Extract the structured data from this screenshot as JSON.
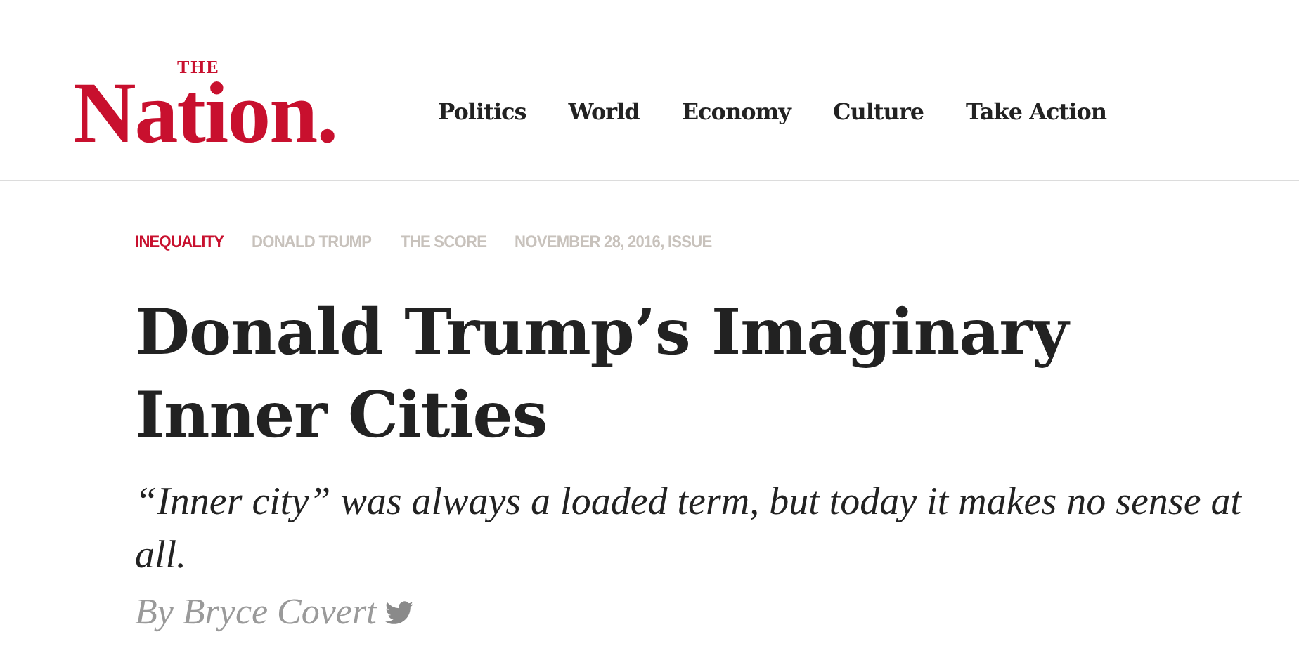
{
  "logo": {
    "small": "THE",
    "main": "Nation."
  },
  "nav": [
    {
      "label": "Politics"
    },
    {
      "label": "World"
    },
    {
      "label": "Economy"
    },
    {
      "label": "Culture"
    },
    {
      "label": "Take Action"
    }
  ],
  "tags": [
    {
      "label": "INEQUALITY",
      "color": "#c8102e"
    },
    {
      "label": "DONALD TRUMP",
      "color": "#c8c2bc"
    },
    {
      "label": "THE SCORE",
      "color": "#c8c2bc"
    },
    {
      "label": "NOVEMBER 28, 2016, ISSUE",
      "color": "#c8c2bc"
    }
  ],
  "headline": "Donald Trump’s Imaginary Inner Cities",
  "dek": "“Inner city” was always a loaded term, but today it makes no sense at all.",
  "byline": "By Bryce Covert"
}
